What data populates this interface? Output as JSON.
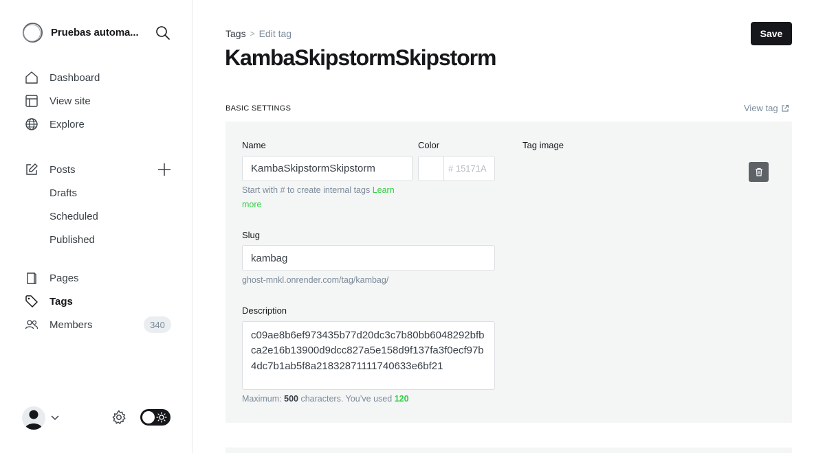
{
  "sidebar": {
    "site_name": "Pruebas automa...",
    "nav": {
      "dashboard": "Dashboard",
      "view_site": "View site",
      "explore": "Explore",
      "posts": "Posts",
      "drafts": "Drafts",
      "scheduled": "Scheduled",
      "published": "Published",
      "pages": "Pages",
      "tags": "Tags",
      "members": "Members",
      "members_count": "340"
    }
  },
  "header": {
    "breadcrumb_parent": "Tags",
    "breadcrumb_separator": ">",
    "breadcrumb_current": "Edit tag",
    "title": "KambaSkipstormSkipstorm",
    "save_label": "Save"
  },
  "basic_settings": {
    "section_title": "Basic settings",
    "view_tag_label": "View tag",
    "name_label": "Name",
    "name_value": "KambaSkipstormSkipstorm",
    "name_hint": "Start with # to create internal tags",
    "name_hint_link": "Learn more",
    "color_label": "Color",
    "color_placeholder": "# 15171A",
    "tag_image_label": "Tag image",
    "slug_label": "Slug",
    "slug_value": "kambag",
    "slug_url": "ghost-mnkl.onrender.com/tag/kambag/",
    "description_label": "Description",
    "description_value": "c09ae8b6ef973435b77d20dc3c7b80bb6048292bfbca2e16b13900d9dcc827a5e158d9f137fa3f0ecf97b4dc7b1ab5f8a21832871111740633e6bf21",
    "desc_hint_prefix": "Maximum:",
    "desc_hint_max": "500",
    "desc_hint_middle": "characters. You’ve used",
    "desc_hint_used": "120"
  },
  "colors": {
    "accent_green": "#30cf43",
    "primary_dark": "#15171a"
  }
}
